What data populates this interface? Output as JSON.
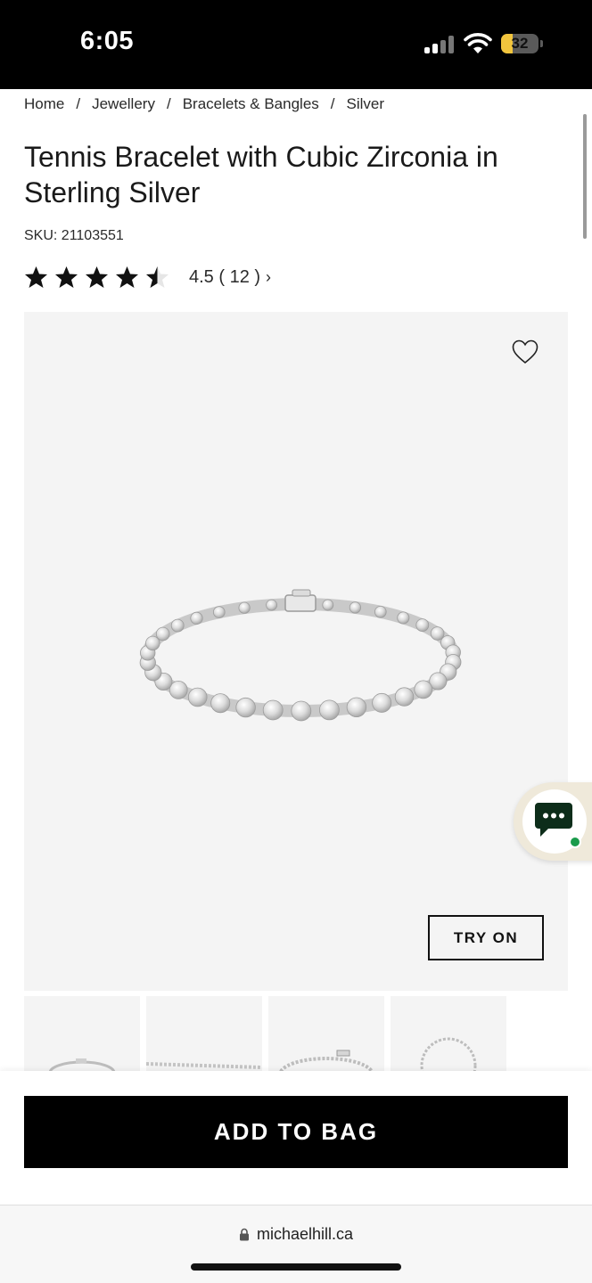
{
  "status_bar": {
    "time": "6:05",
    "battery": "32",
    "battery_level": 0.32
  },
  "breadcrumb": [
    {
      "label": "Home"
    },
    {
      "label": "Jewellery"
    },
    {
      "label": "Bracelets & Bangles"
    },
    {
      "label": "Silver"
    }
  ],
  "breadcrumb_separator": "/",
  "product": {
    "title": "Tennis Bracelet with Cubic Zirconia in Sterling Silver",
    "sku": "SKU: 21103551",
    "rating": {
      "value": 4.5,
      "max": 5,
      "text": "4.5 ( 12 )",
      "chevron": "›"
    },
    "try_on_label": "TRY ON",
    "wishlist_icon": "heart-outline-icon",
    "thumbnail_count": 4
  },
  "actions": {
    "add_to_bag_label": "ADD TO BAG"
  },
  "chat": {
    "icon": "chat-bubble-icon",
    "status_color": "#1a9b4b"
  },
  "browser": {
    "url": "michaelhill.ca"
  },
  "colors": {
    "primary_button": "#000000",
    "image_background": "#f4f4f4",
    "chat_background": "#efe9da"
  }
}
